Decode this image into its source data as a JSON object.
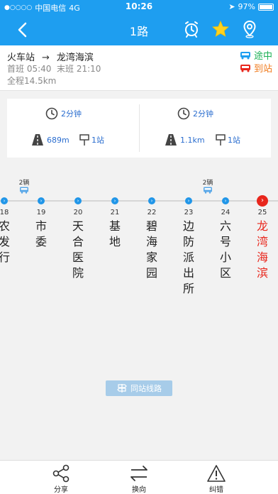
{
  "status": {
    "carrier": "中国电信",
    "network": "4G",
    "time": "10:26",
    "battery": "97%"
  },
  "nav": {
    "title": "1路"
  },
  "route": {
    "from": "火车站",
    "arrow": "→",
    "to": "龙湾海滨",
    "first_bus": "首班 05:40",
    "last_bus": "末班 21:10",
    "total_length": "全程14.5km"
  },
  "legend": {
    "onway": "途中",
    "arrive": "到站"
  },
  "bus_info": [
    {
      "eta": "2分钟",
      "distance": "689m",
      "stops": "1站"
    },
    {
      "eta": "2分钟",
      "distance": "1.1km",
      "stops": "1站"
    }
  ],
  "bus_markers": [
    {
      "label": "2辆"
    },
    {
      "label": "2辆"
    }
  ],
  "stops": [
    {
      "num": "18",
      "name": "农发行"
    },
    {
      "num": "19",
      "name": "市委"
    },
    {
      "num": "20",
      "name": "天合医院"
    },
    {
      "num": "21",
      "name": "基地"
    },
    {
      "num": "22",
      "name": "碧海家园"
    },
    {
      "num": "23",
      "name": "边防派出所"
    },
    {
      "num": "24",
      "name": "六号小区"
    },
    {
      "num": "25",
      "name": "龙湾海滨"
    }
  ],
  "same_stop_button": "同站线路",
  "tabs": {
    "share": "分享",
    "switch": "换向",
    "report": "纠错"
  },
  "colors": {
    "primary": "#1e9ef0",
    "current_stop": "#e8261c",
    "onway": "#1cb055",
    "arrive": "#f07a1c"
  }
}
